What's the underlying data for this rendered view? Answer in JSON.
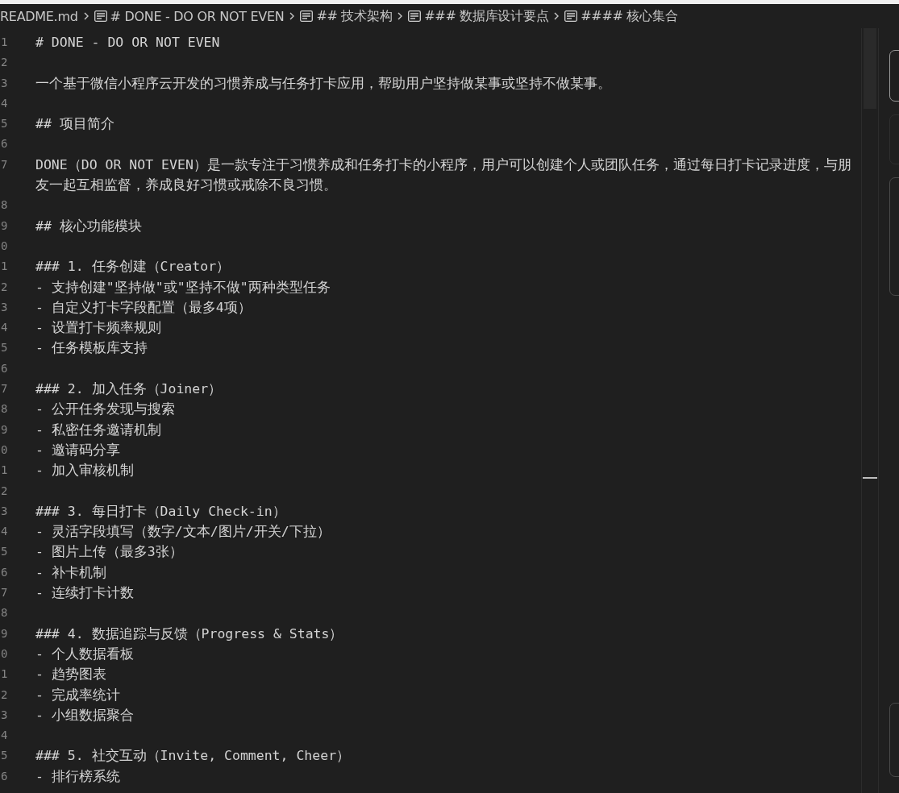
{
  "breadcrumbs": [
    {
      "label": "README.md",
      "kind": "file"
    },
    {
      "label": "# DONE - DO OR NOT EVEN",
      "kind": "heading"
    },
    {
      "label": "## 技术架构",
      "kind": "heading"
    },
    {
      "label": "### 数据库设计要点",
      "kind": "heading"
    },
    {
      "label": "#### 核心集合",
      "kind": "heading"
    }
  ],
  "editor": {
    "lines": [
      {
        "number": "1",
        "text": "# DONE - DO OR NOT EVEN"
      },
      {
        "number": "2"
      },
      {
        "number": "3",
        "text": "一个基于微信小程序云开发的习惯养成与任务打卡应用，帮助用户坚持做某事或坚持不做某事。"
      },
      {
        "number": "4"
      },
      {
        "number": "5",
        "text": "## 项目简介"
      },
      {
        "number": "6"
      },
      {
        "number": "7",
        "text": "DONE（DO OR NOT EVEN）是一款专注于习惯养成和任务打卡的小程序，用户可以创建个人或团队任务，通过每日打卡记录进度，与朋友一起互相监督，养成良好习惯或戒除不良习惯。"
      },
      {
        "number": "8"
      },
      {
        "number": "9",
        "text": "## 核心功能模块"
      },
      {
        "number": "0"
      },
      {
        "number": "1",
        "text": "### 1. 任务创建（Creator）"
      },
      {
        "number": "2",
        "text": "- 支持创建\"坚持做\"或\"坚持不做\"两种类型任务"
      },
      {
        "number": "3",
        "text": "- 自定义打卡字段配置（最多4项）"
      },
      {
        "number": "4",
        "text": "- 设置打卡频率规则"
      },
      {
        "number": "5",
        "text": "- 任务模板库支持"
      },
      {
        "number": "6"
      },
      {
        "number": "7",
        "text": "### 2. 加入任务（Joiner）"
      },
      {
        "number": "8",
        "text": "- 公开任务发现与搜索"
      },
      {
        "number": "9",
        "text": "- 私密任务邀请机制"
      },
      {
        "number": "0",
        "text": "- 邀请码分享"
      },
      {
        "number": "1",
        "text": "- 加入审核机制"
      },
      {
        "number": "2"
      },
      {
        "number": "3",
        "text": "### 3. 每日打卡（Daily Check-in）"
      },
      {
        "number": "4",
        "text": "- 灵活字段填写（数字/文本/图片/开关/下拉）"
      },
      {
        "number": "5",
        "text": "- 图片上传（最多3张）"
      },
      {
        "number": "6",
        "text": "- 补卡机制"
      },
      {
        "number": "7",
        "text": "- 连续打卡计数"
      },
      {
        "number": "8"
      },
      {
        "number": "9",
        "text": "### 4. 数据追踪与反馈（Progress & Stats）"
      },
      {
        "number": "0",
        "text": "- 个人数据看板"
      },
      {
        "number": "1",
        "text": "- 趋势图表"
      },
      {
        "number": "2",
        "text": "- 完成率统计"
      },
      {
        "number": "3",
        "text": "- 小组数据聚合"
      },
      {
        "number": "4"
      },
      {
        "number": "5",
        "text": "### 5. 社交互动（Invite, Comment, Cheer）"
      },
      {
        "number": "6",
        "text": "- 排行榜系统"
      }
    ]
  }
}
